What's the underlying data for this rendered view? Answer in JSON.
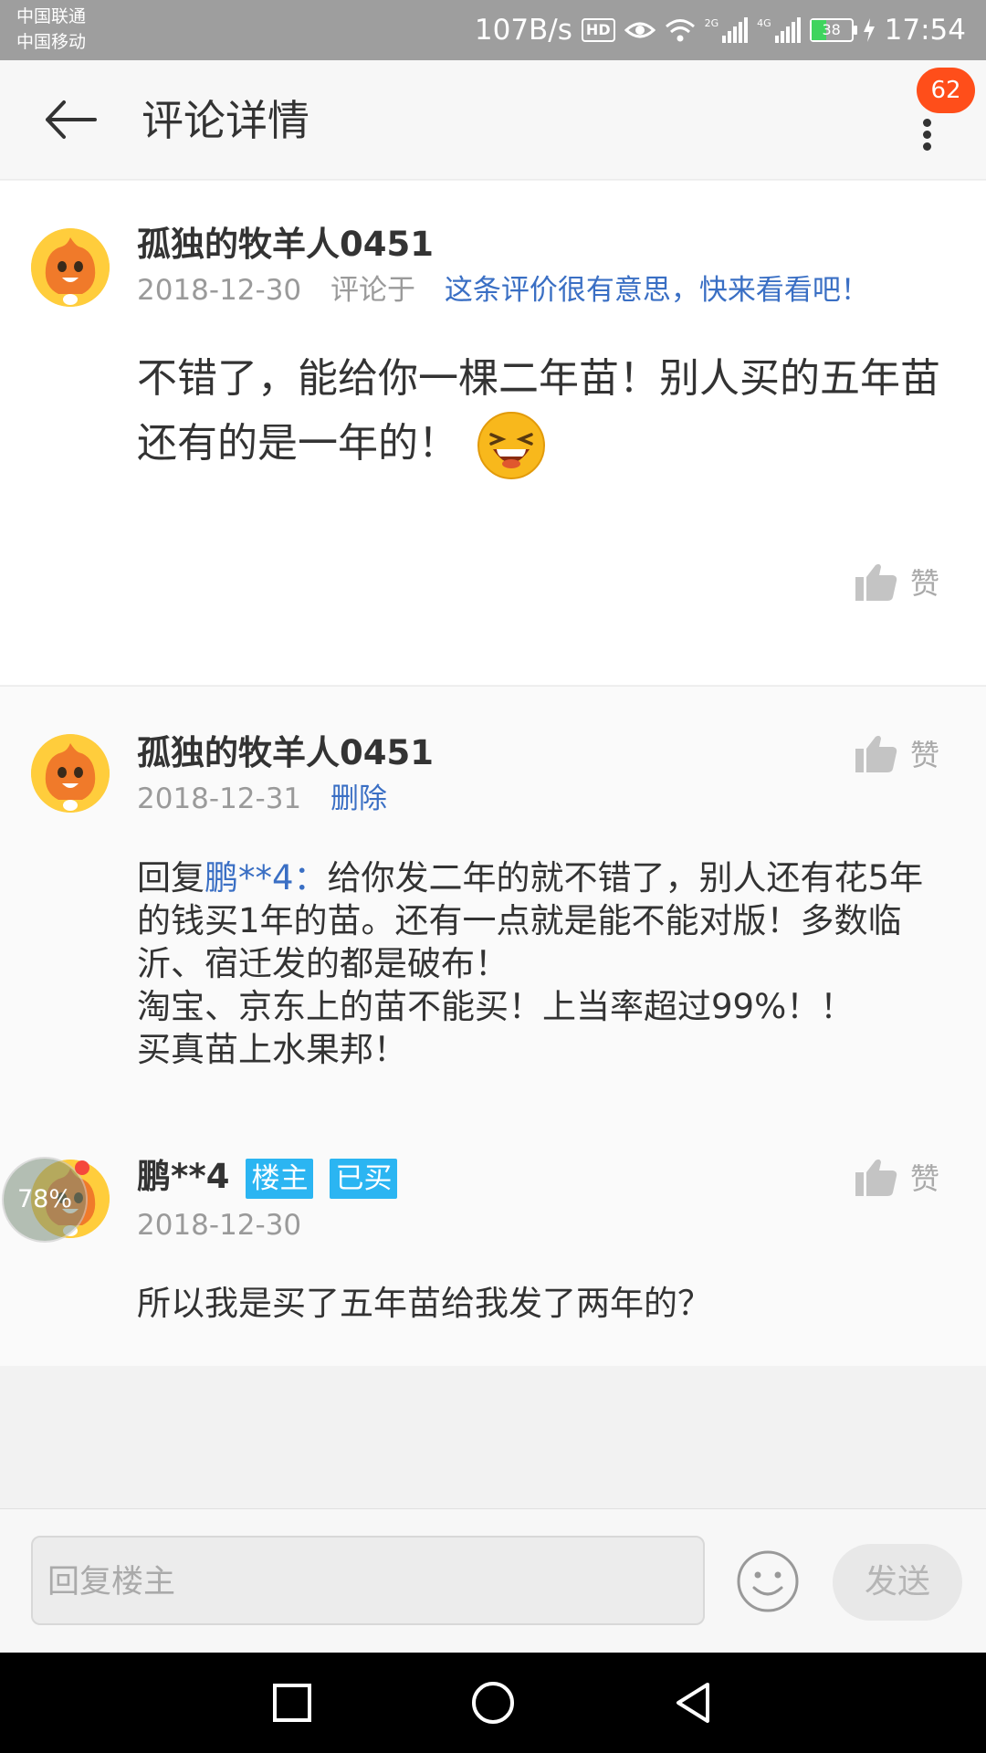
{
  "status_bar": {
    "carrier1": "中国联通",
    "carrier2": "中国移动",
    "speed": "107B/s",
    "hd": "HD",
    "net2g": "2G",
    "net4g": "4G",
    "battery": "38",
    "time": "17:54"
  },
  "header": {
    "title": "评论详情",
    "notification_count": "62",
    "back_icon": "arrow-left-icon",
    "more_icon": "more-vertical-icon"
  },
  "main_comment": {
    "username": "孤独的牧羊人0451",
    "date": "2018-12-30",
    "commented_on_label": "评论于",
    "link_text": "这条评价很有意思，快来看看吧！",
    "text": "不错了，能给你一棵二年苗！别人买的五年苗还有的是一年的！",
    "like_label": "赞"
  },
  "replies": [
    {
      "username": "孤独的牧羊人0451",
      "date": "2018-12-31",
      "delete_label": "删除",
      "reply_prefix": "回复",
      "reply_to": "鹏**4：",
      "text": "给你发二年的就不错了，别人还有花5年的钱买1年的苗。还有一点就是能不能对版！多数临沂、宿迁发的都是破布！\n淘宝、京东上的苗不能买！上当率超过99%！！\n买真苗上水果邦！",
      "like_label": "赞"
    },
    {
      "username": "鹏**4",
      "tag_owner": "楼主",
      "tag_bought": "已买",
      "date": "2018-12-30",
      "text": "所以我是买了五年苗给我发了两年的？",
      "like_label": "赞",
      "progress_overlay": "78%"
    }
  ],
  "input_bar": {
    "placeholder": "回复楼主",
    "send_label": "发送"
  },
  "colors": {
    "link": "#3a6fc4",
    "tag": "#2bb5f2",
    "badge": "#ff4e1a"
  }
}
